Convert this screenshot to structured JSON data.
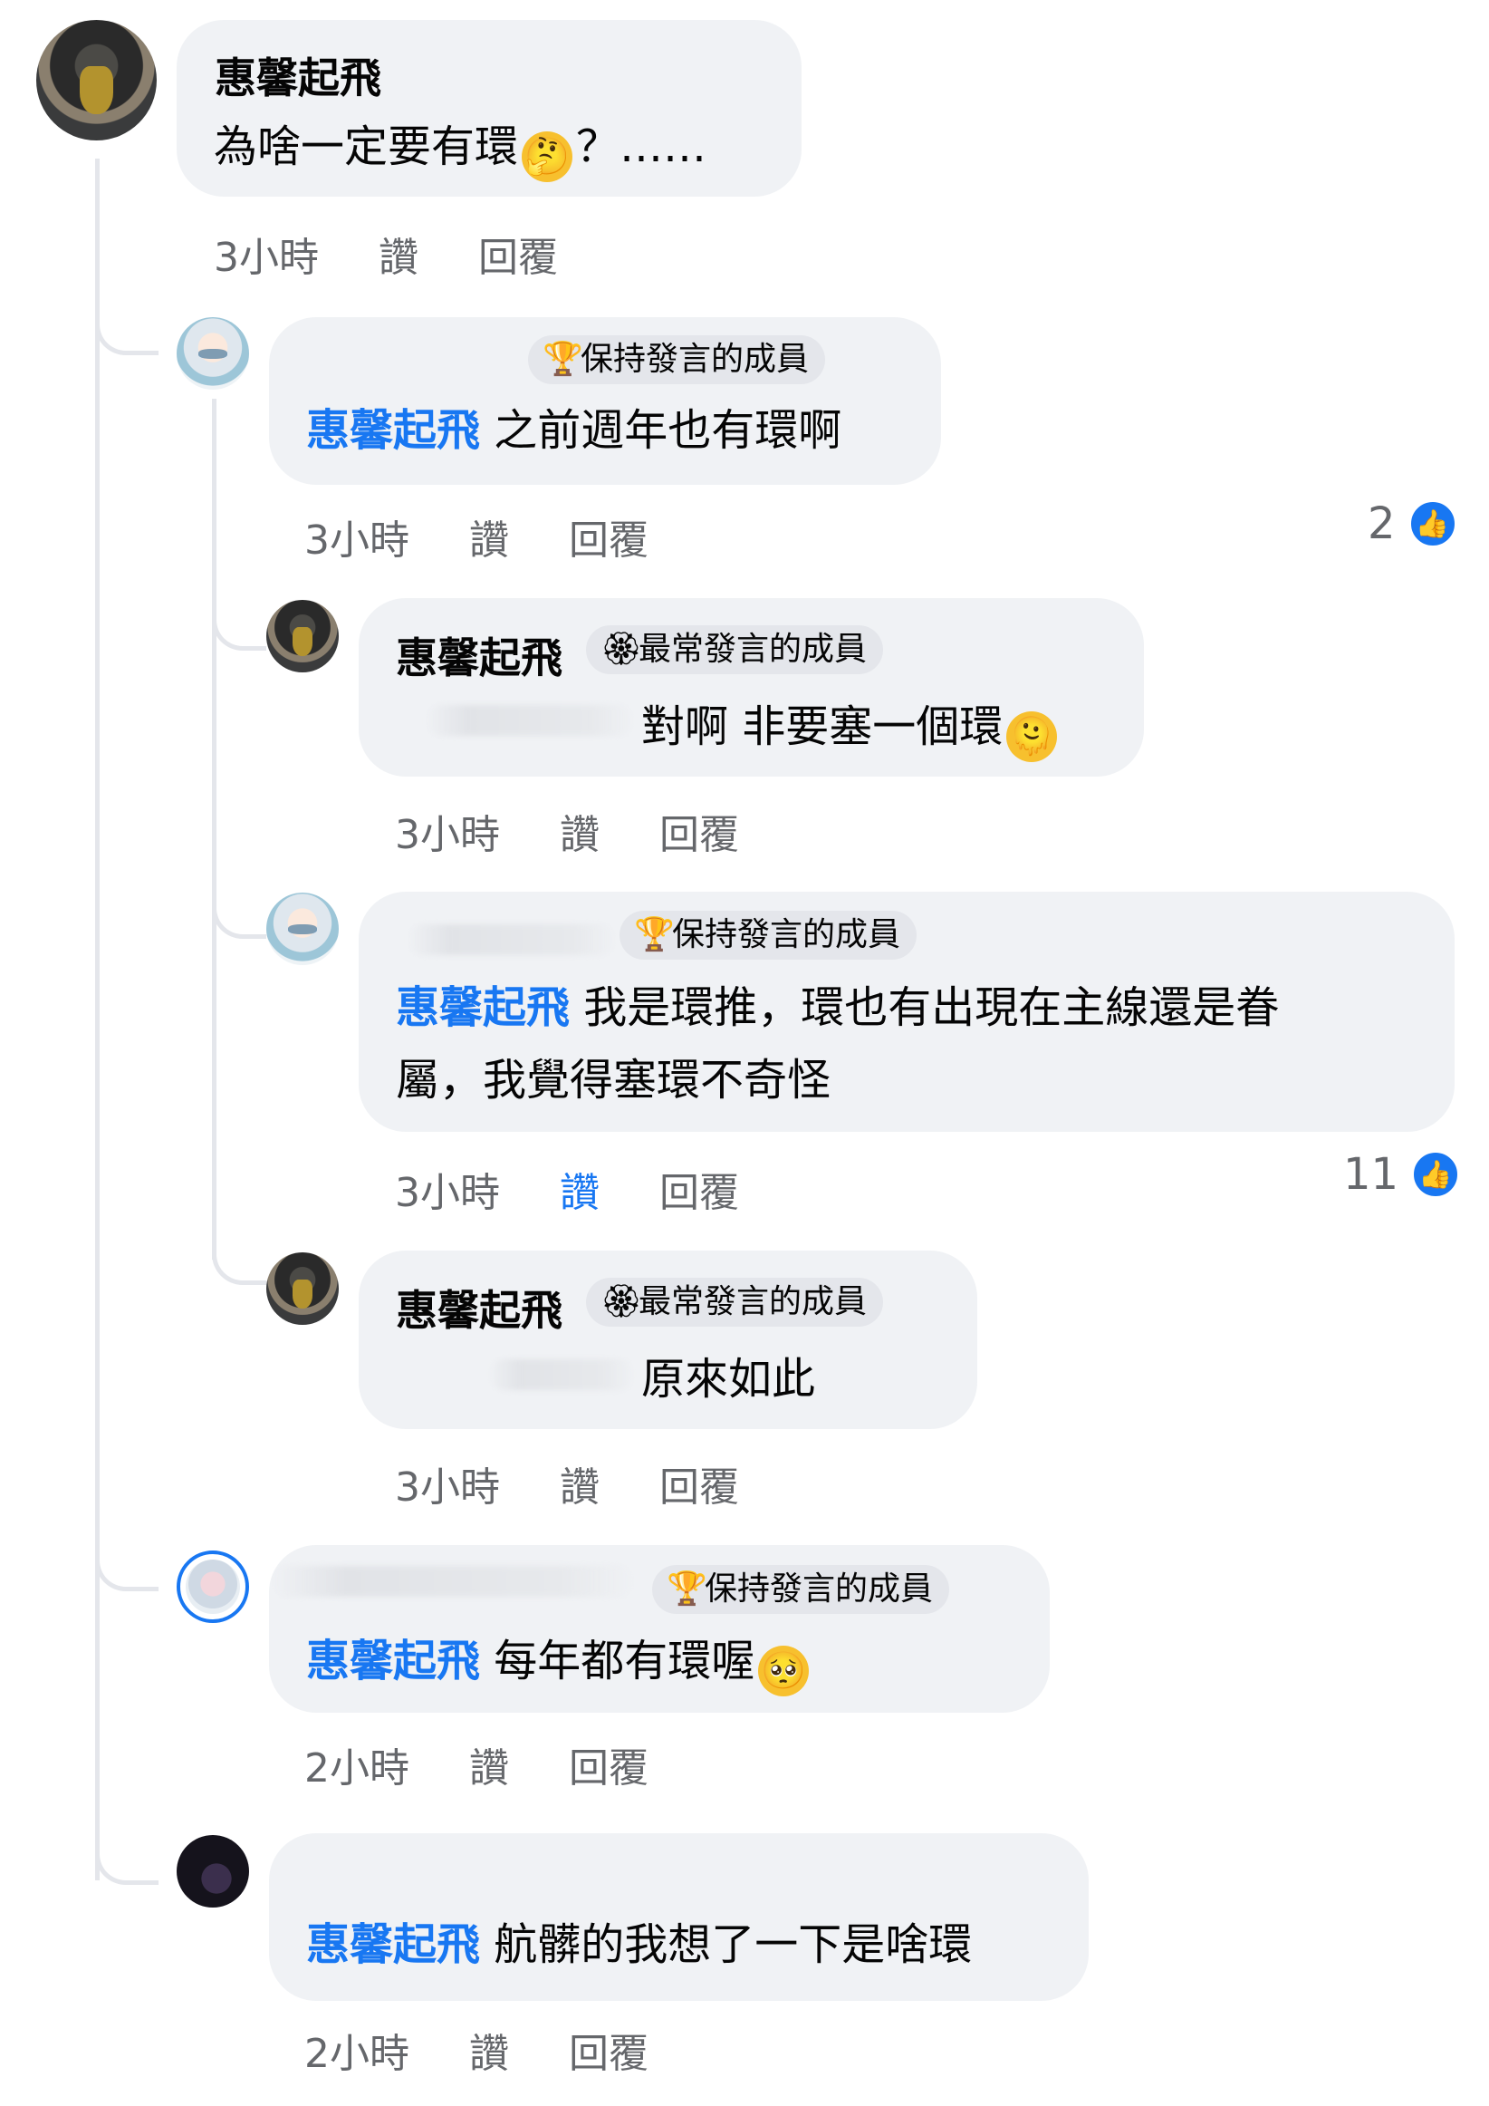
{
  "comments": [
    {
      "author": "惠馨起飛",
      "text": "為啥一定要有環",
      "emoji": "thinking-face",
      "text_suffix": "？……",
      "time": "3小時",
      "like": "讚",
      "reply": "回覆"
    },
    {
      "badge": "保持發言的成員",
      "badge_icon": "trophy-icon",
      "mention": "惠馨起飛",
      "text": "之前週年也有環啊",
      "time": "3小時",
      "like": "讚",
      "reply": "回覆",
      "reaction_count": "2"
    },
    {
      "author": "惠馨起飛",
      "badge": "最常發言的成員",
      "badge_icon": "rosette-icon",
      "text": "對啊 非要塞一個環",
      "emoji": "melting-face",
      "time": "3小時",
      "like": "讚",
      "reply": "回覆"
    },
    {
      "badge": "保持發言的成員",
      "badge_icon": "trophy-icon",
      "mention": "惠馨起飛",
      "text_line1": "我是環推，環也有出現在主線還是眷",
      "text_line2": "屬，我覺得塞環不奇怪",
      "time": "3小時",
      "like": "讚",
      "reply": "回覆",
      "reaction_count": "11"
    },
    {
      "author": "惠馨起飛",
      "badge": "最常發言的成員",
      "badge_icon": "rosette-icon",
      "text": "原來如此",
      "time": "3小時",
      "like": "讚",
      "reply": "回覆"
    },
    {
      "badge": "保持發言的成員",
      "badge_icon": "trophy-icon",
      "mention": "惠馨起飛",
      "text": "每年都有環喔",
      "emoji": "pleading-face",
      "time": "2小時",
      "like": "讚",
      "reply": "回覆"
    },
    {
      "mention": "惠馨起飛",
      "text": "航髒的我想了一下是啥環",
      "time": "2小時",
      "like": "讚",
      "reply": "回覆"
    }
  ],
  "colors": {
    "bubble": "#f0f2f5",
    "mention": "#1877f2",
    "meta": "#65676b",
    "thread_line": "#e4e6eb"
  }
}
